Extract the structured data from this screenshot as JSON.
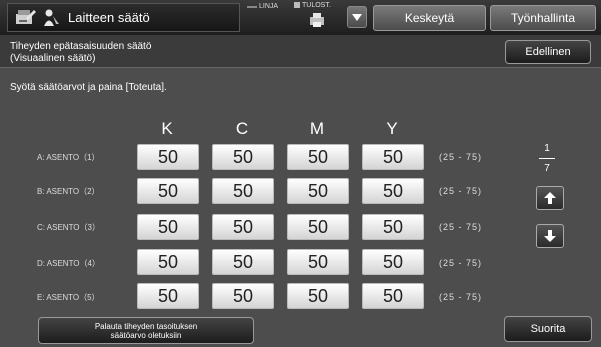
{
  "header": {
    "title": "Laitteen säätö",
    "linja_label": "LINJA",
    "tulost_label": "TULOST.",
    "pause_label": "Keskeytä",
    "jobs_label": "Työnhallinta"
  },
  "subheader": {
    "title_line1": "Tiheyden epätasaisuuden säätö",
    "title_line2": "(Visuaalinen säätö)",
    "back_label": "Edellinen"
  },
  "instruction": "Syötä säätöarvot ja paina [Toteuta].",
  "columns": [
    "K",
    "C",
    "M",
    "Y"
  ],
  "rows": [
    {
      "label": "A: ASENTO（1）",
      "values": [
        "50",
        "50",
        "50",
        "50"
      ],
      "range": "(25 - 75)"
    },
    {
      "label": "B: ASENTO（2）",
      "values": [
        "50",
        "50",
        "50",
        "50"
      ],
      "range": "(25 - 75)"
    },
    {
      "label": "C: ASENTO（3）",
      "values": [
        "50",
        "50",
        "50",
        "50"
      ],
      "range": "(25 - 75)"
    },
    {
      "label": "D: ASENTO（4）",
      "values": [
        "50",
        "50",
        "50",
        "50"
      ],
      "range": "(25 - 75)"
    },
    {
      "label": "E: ASENTO（5）",
      "values": [
        "50",
        "50",
        "50",
        "50"
      ],
      "range": "(25 - 75)"
    }
  ],
  "pager": {
    "current": "1",
    "total": "7"
  },
  "footer": {
    "reset_line1": "Palauta tiheyden tasoituksen",
    "reset_line2": "säätöarvo oletuksiin",
    "execute_label": "Suorita"
  },
  "icons": {
    "app": "machine-adjust-icon",
    "user": "user-icon",
    "printer": "printer-icon",
    "dropdown": "triangle-down-icon",
    "up": "arrow-up-icon",
    "down": "arrow-down-icon"
  }
}
